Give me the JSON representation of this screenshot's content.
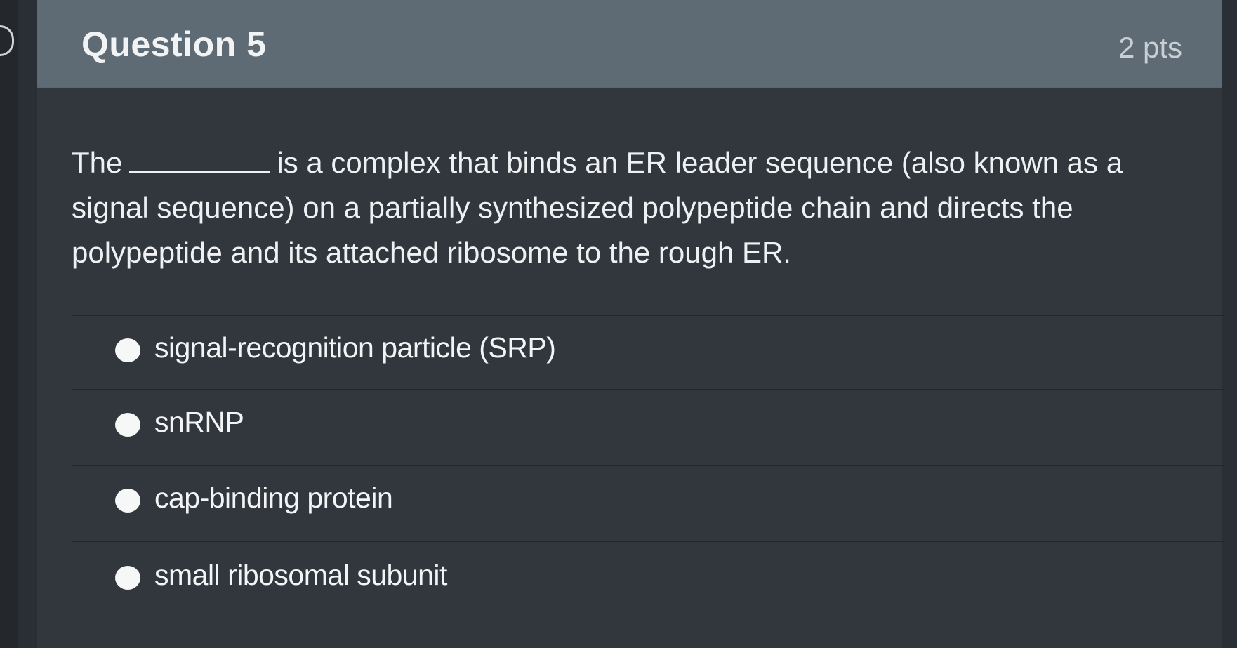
{
  "question": {
    "title": "Question 5",
    "points": "2 pts",
    "text_before_blank": "The",
    "text_after_blank": "is a complex that binds an ER leader sequence (also known as a signal sequence) on a partially synthesized polypeptide chain and directs the polypeptide and its attached ribosome to the rough ER."
  },
  "answers": [
    {
      "label": "signal-recognition particle (SRP)"
    },
    {
      "label": "snRNP"
    },
    {
      "label": "cap-binding protein"
    },
    {
      "label": "small ribosomal subunit"
    }
  ],
  "colors": {
    "background": "#2a2f35",
    "card": "#32373e",
    "header": "#5f6b74",
    "text": "#eef0f2",
    "radio": "#f6f7f7"
  }
}
